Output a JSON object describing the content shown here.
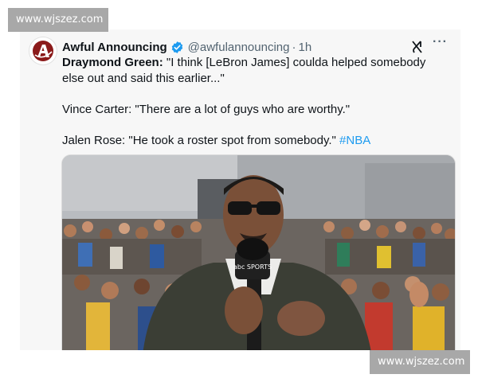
{
  "watermarks": {
    "top": "www.wjszez.com",
    "bottom": "www.wjszez.com"
  },
  "tweet": {
    "display_name": "Awful Announcing",
    "handle": "@awfulannouncing",
    "separator": "·",
    "time": "1h",
    "lines": [
      {
        "speaker": "Draymond Green:",
        "text": " \"I think [LeBron James] coulda helped somebody else out and said this earlier...\""
      },
      {
        "text": "Vince Carter: \"There are a lot of guys who are worthy.\""
      },
      {
        "text": "Jalen Rose: \"He took a roster spot from somebody.\" ",
        "hashtag": "#NBA"
      }
    ]
  },
  "media": {
    "mic_logo": "abc SPORTS"
  },
  "icons": {
    "verified": "verified-badge-icon",
    "grok": "grok-icon",
    "more": "more-options-icon",
    "avatar": "awful-announcing-logo"
  },
  "colors": {
    "verified": "#1d9bf0",
    "hashtag": "#1d9bf0",
    "handle": "#536471",
    "logo_red": "#8b1a1a"
  }
}
